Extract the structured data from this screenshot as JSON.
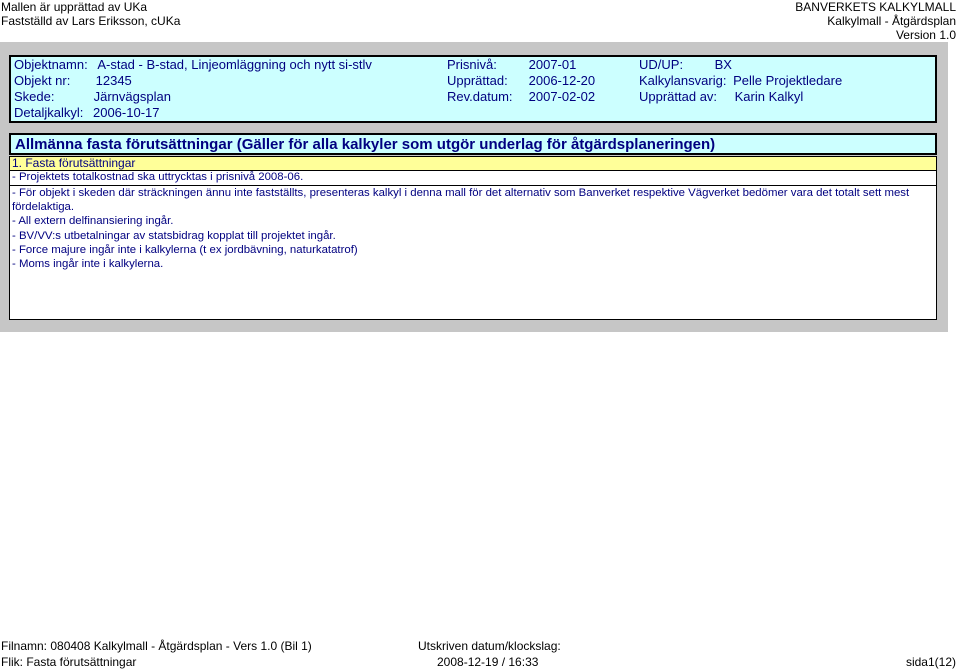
{
  "header": {
    "left_line1": "Mallen är upprättad av UKa",
    "left_line2": "Fastställd av Lars Eriksson, cUKa",
    "right_line1": "BANVERKETS KALKYLMALL",
    "right_line2": "Kalkylmall - Åtgärdsplan",
    "right_line3": "Version 1.0"
  },
  "info": {
    "objektnamn_label": "Objektnamn:",
    "objektnamn_value": "A-stad - B-stad, Linjeomläggning och nytt si-stlv",
    "objektnr_label": "Objekt nr:",
    "objektnr_value": "12345",
    "skede_label": "Skede:",
    "skede_value": "Järnvägsplan",
    "detaljkalkyl_label": "Detaljkalkyl:",
    "detaljkalkyl_value": "2006-10-17",
    "prisniva_label": "Prisnivå:",
    "prisniva_value": "2007-01",
    "upprattad_label": "Upprättad:",
    "upprattad_value": "2006-12-20",
    "revdatum_label": "Rev.datum:",
    "revdatum_value": "2007-02-02",
    "udup_label": "UD/UP:",
    "udup_value": "BX",
    "kalkylansvarig_label": "Kalkylansvarig:",
    "kalkylansvarig_value": "Pelle Projektledare",
    "upprattad_av_label": "Upprättad av:",
    "upprattad_av_value": "Karin Kalkyl"
  },
  "section": {
    "title": "Allmänna fasta förutsättningar (Gäller för alla kalkyler som utgör underlag för åtgärdsplaneringen)",
    "subheading": "1. Fasta förutsättningar",
    "first_line": "- Projektets totalkostnad ska uttrycktas i prisnivå 2008-06.",
    "lines": [
      "- För objekt i skeden där sträckningen ännu inte fastställts, presenteras kalkyl i denna mall för det alternativ som Banverket respektive Vägverket bedömer vara det totalt sett mest fördelaktiga.",
      "- All extern delfinansiering ingår.",
      "- BV/VV:s utbetalningar av statsbidrag kopplat till projektet ingår.",
      "- Force majure ingår inte i kalkylerna (t ex jordbävning, naturkatatrof)",
      "- Moms ingår inte i kalkylerna."
    ]
  },
  "footer": {
    "filnamn": "Filnamn: 080408 Kalkylmall - Åtgärdsplan - Vers 1.0 (Bil 1)",
    "flik": "Flik: Fasta förutsättningar",
    "utskriven_label": "Utskriven datum/klockslag:",
    "utskriven_value": "2008-12-19 / 16:33",
    "sida": "sida1(12)"
  }
}
